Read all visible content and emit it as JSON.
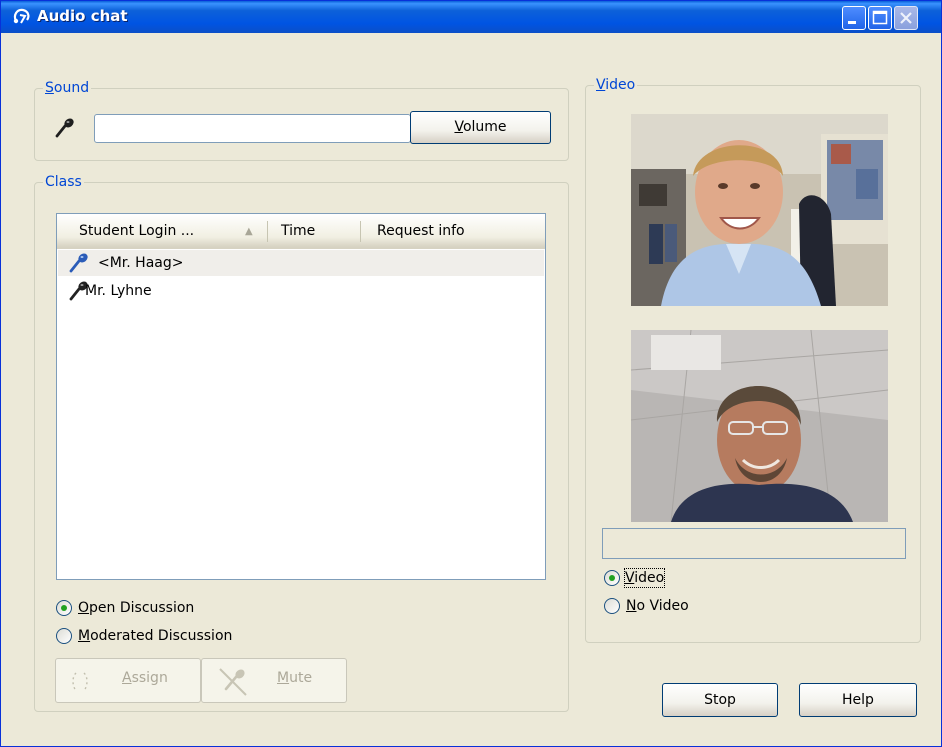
{
  "window": {
    "title": "Audio chat",
    "accent_color": "#0054e3",
    "controls": [
      "minimize-icon",
      "maximize-icon",
      "close-icon"
    ]
  },
  "sound": {
    "group_label": "Sound",
    "group_mnemonic": "S",
    "group_rest": "ound",
    "level_value": "",
    "volume_button_mnemonic": "V",
    "volume_button_rest": "olume",
    "icon": "microphone-icon"
  },
  "class": {
    "group_label": "Class",
    "columns": [
      "Student Login ...",
      "Time",
      "Request info"
    ],
    "sort_indicator": "▲",
    "rows": [
      {
        "name": "<Mr. Haag>",
        "icon": "microphone-icon",
        "icon_color": "#2b5cb8",
        "selected": true
      },
      {
        "name": "Mr. Lyhne",
        "icon": "microphone-icon",
        "icon_color": "#222222",
        "selected": false
      }
    ],
    "mode_options": [
      {
        "mnemonic": "O",
        "rest": "pen Discussion",
        "checked": true
      },
      {
        "mnemonic": "M",
        "rest": "oderated Discussion",
        "checked": false
      }
    ],
    "assign_button": {
      "mnemonic": "A",
      "rest": "ssign",
      "enabled": false
    },
    "mute_button": {
      "mnemonic": "M",
      "rest": "ute",
      "enabled": false
    }
  },
  "video": {
    "group_mnemonic": "V",
    "group_rest": "ideo",
    "status_text": "",
    "options": [
      {
        "mnemonic": "V",
        "rest": "ideo",
        "checked": true
      },
      {
        "mnemonic": "N",
        "rest": "o Video",
        "checked": false
      }
    ],
    "feeds": [
      "video-feed-teacher",
      "video-feed-student"
    ]
  },
  "footer": {
    "stop_label": "Stop",
    "help_label": "Help"
  }
}
